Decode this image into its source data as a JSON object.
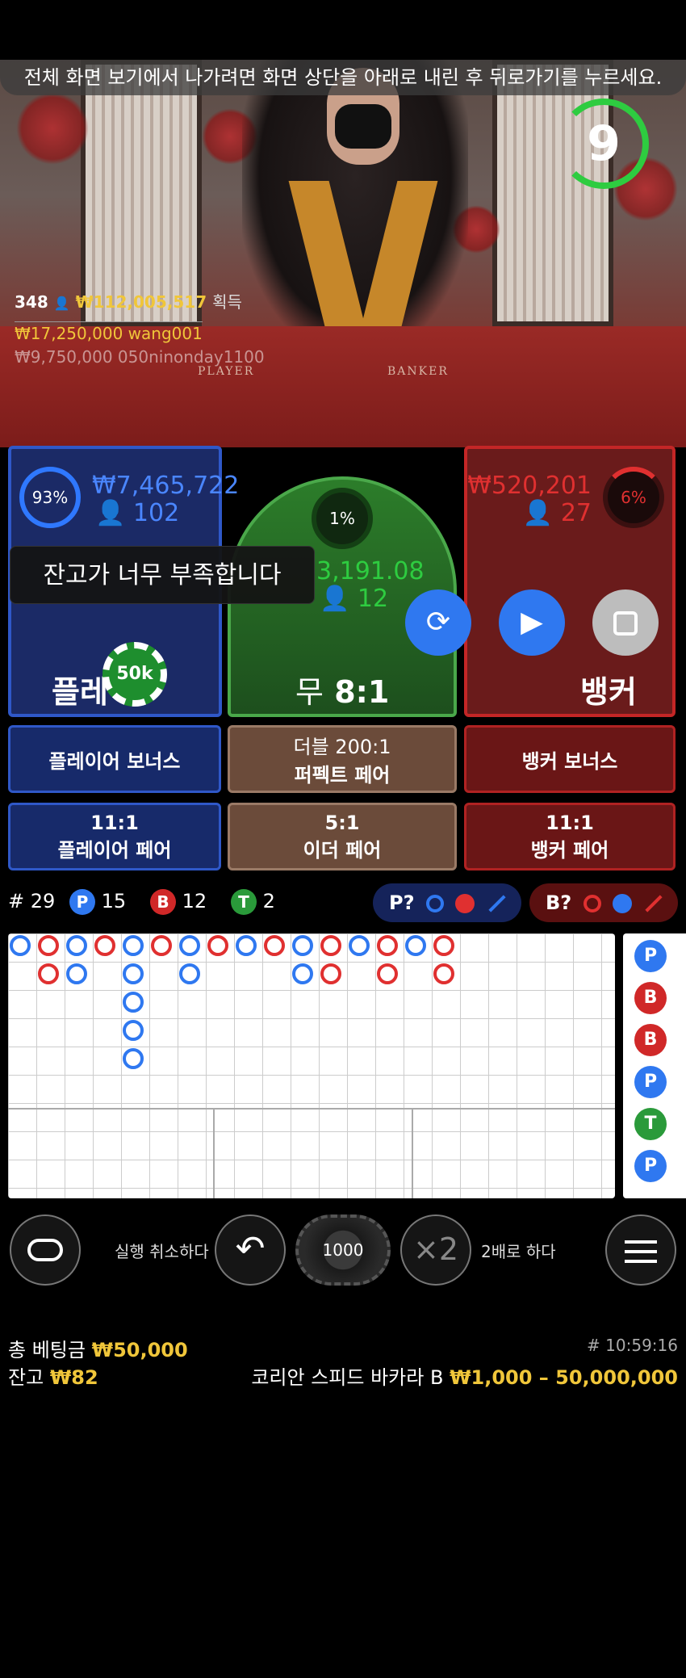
{
  "notice": "전체 화면 보기에서 나가려면 화면 상단을 아래로 내린 후 뒤로가기를 누르세요.",
  "timer": "9",
  "players_count": "348",
  "top_win_amount": "₩112,005,517",
  "top_win_suffix": "획득",
  "winner_row1_amount": "₩17,250,000",
  "winner_row1_name": "wang001",
  "winner_row2": "₩9,750,000  050ninonday1100",
  "felt_player": "PLAYER",
  "felt_banker": "BANKER",
  "player": {
    "percent": "93%",
    "amount": "₩7,465,722",
    "count": "102",
    "name_part1": "플레",
    "name_part2": "",
    "pct_value": 0.93
  },
  "tie": {
    "percent": "1%",
    "amount": "3,191.08",
    "count": "12",
    "name": "무",
    "payout": "8:1"
  },
  "banker": {
    "percent": "6%",
    "amount": "₩520,201",
    "count": "27",
    "name": "뱅커"
  },
  "toast": "잔고가 너무 부족합니다",
  "chip_label": "50k",
  "side_bets": {
    "player_bonus": "플레이어 보너스",
    "perfect_pair_top": "더블 200:1",
    "perfect_pair_bottom": "퍼펙트 페어",
    "banker_bonus": "뱅커 보너스",
    "player_pair_top": "11:1",
    "player_pair_bottom": "플레이어 페어",
    "either_pair_top": "5:1",
    "either_pair_bottom": "이더 페어",
    "banker_pair_top": "11:1",
    "banker_pair_bottom": "뱅커 페어"
  },
  "stats": {
    "round_label": "# 29",
    "p_badge": "P",
    "p_count": "15",
    "b_badge": "B",
    "b_count": "12",
    "t_badge": "T",
    "t_count": "2"
  },
  "predict": {
    "player": "P?",
    "banker": "B?"
  },
  "side_board": [
    "P",
    "B",
    "B",
    "P",
    "T",
    "P"
  ],
  "controls": {
    "undo_label": "실행 취소하다",
    "chip_value": "1000",
    "double_icon": "×2",
    "double_label": "2배로 하다"
  },
  "footer": {
    "total_bet_label": "총 베팅금",
    "total_bet_value": "₩50,000",
    "balance_label": "잔고",
    "balance_value": "₩82",
    "time": "# 10:59:16",
    "table_name": "코리안 스피드 바카라 B",
    "limits": "₩1,000 – 50,000,000"
  },
  "colors": {
    "player_blue": "#2f78ff",
    "banker_red": "#e03030",
    "tie_green": "#2ecc40",
    "gold": "#f0c63a"
  }
}
